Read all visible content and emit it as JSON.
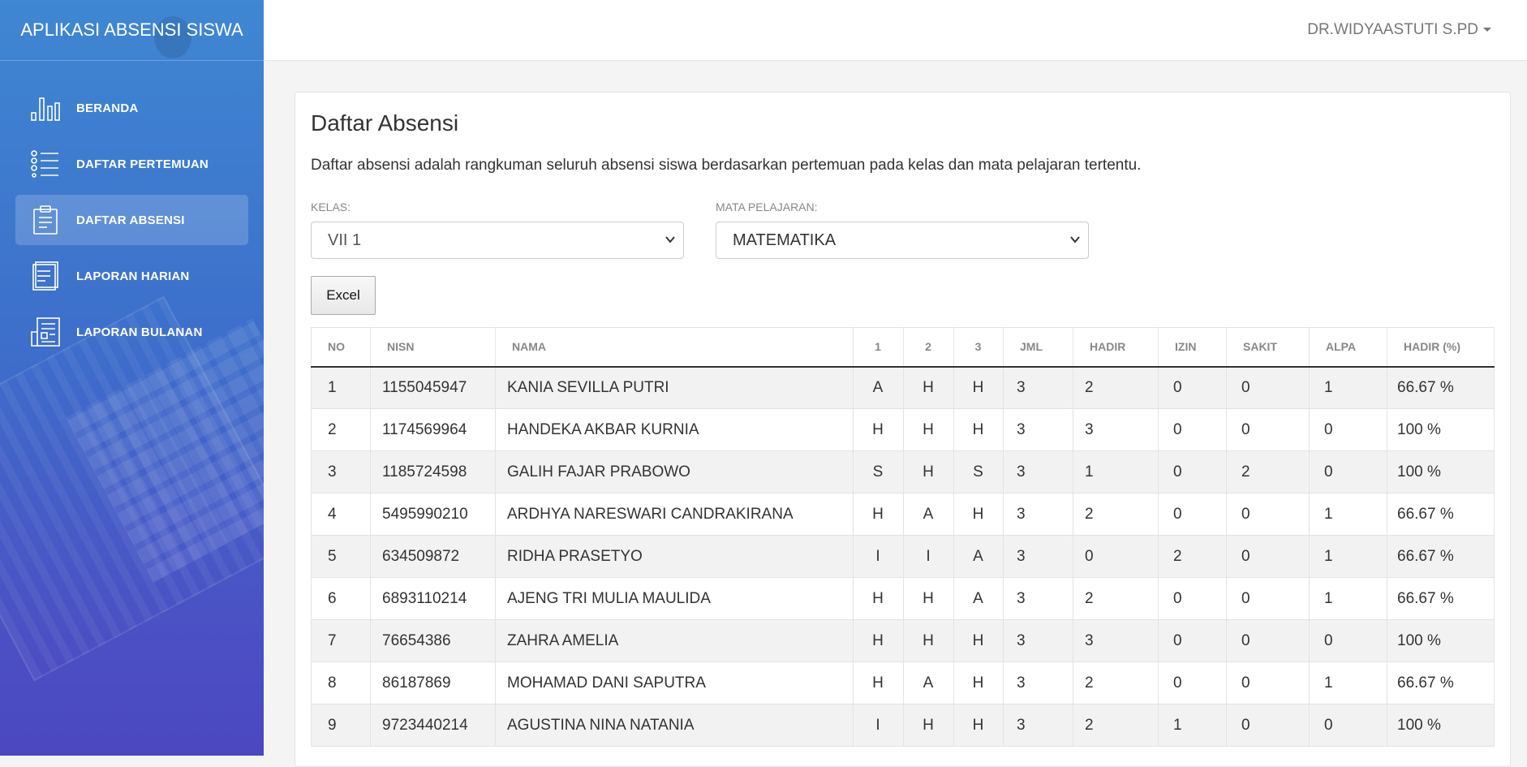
{
  "app": {
    "title": "APLIKASI ABSENSI SISWA"
  },
  "user": {
    "name": "DR.WIDYAASTUTI S.PD"
  },
  "sidebar": {
    "items": [
      {
        "label": "BERANDA",
        "icon": "bar-chart-icon",
        "active": false
      },
      {
        "label": "DAFTAR PERTEMUAN",
        "icon": "list-icon",
        "active": false
      },
      {
        "label": "DAFTAR ABSENSI",
        "icon": "clipboard-icon",
        "active": true
      },
      {
        "label": "LAPORAN HARIAN",
        "icon": "document-icon",
        "active": false
      },
      {
        "label": "LAPORAN BULANAN",
        "icon": "report-icon",
        "active": false
      }
    ]
  },
  "main": {
    "title": "Daftar Absensi",
    "description": "Daftar absensi adalah rangkuman seluruh absensi siswa berdasarkan pertemuan pada kelas dan mata pelajaran tertentu.",
    "kelas": {
      "label": "KELAS:",
      "value": "VII 1"
    },
    "mapel": {
      "label": "MATA PELAJARAN:",
      "value": "MATEMATIKA"
    },
    "excel_label": "Excel"
  },
  "status_colors": {
    "H": "#7ac029",
    "A": "#f04747",
    "S": "#32b2e0",
    "I": "#f39a33"
  },
  "table": {
    "headers": [
      "NO",
      "NISN",
      "NAMA",
      "1",
      "2",
      "3",
      "JML",
      "HADIR",
      "IZIN",
      "SAKIT",
      "ALPA",
      "HADIR (%)"
    ],
    "rows": [
      [
        "1",
        "1155045947",
        "KANIA SEVILLA PUTRI",
        "A",
        "H",
        "H",
        "3",
        "2",
        "0",
        "0",
        "1",
        "66.67 %"
      ],
      [
        "2",
        "1174569964",
        "HANDEKA AKBAR KURNIA",
        "H",
        "H",
        "H",
        "3",
        "3",
        "0",
        "0",
        "0",
        "100 %"
      ],
      [
        "3",
        "1185724598",
        "GALIH FAJAR PRABOWO",
        "S",
        "H",
        "S",
        "3",
        "1",
        "0",
        "2",
        "0",
        "100 %"
      ],
      [
        "4",
        "5495990210",
        "ARDHYA NARESWARI CANDRAKIRANA",
        "H",
        "A",
        "H",
        "3",
        "2",
        "0",
        "0",
        "1",
        "66.67 %"
      ],
      [
        "5",
        "634509872",
        "RIDHA PRASETYO",
        "I",
        "I",
        "A",
        "3",
        "0",
        "2",
        "0",
        "1",
        "66.67 %"
      ],
      [
        "6",
        "6893110214",
        "AJENG TRI MULIA MAULIDA",
        "H",
        "H",
        "A",
        "3",
        "2",
        "0",
        "0",
        "1",
        "66.67 %"
      ],
      [
        "7",
        "76654386",
        "ZAHRA AMELIA",
        "H",
        "H",
        "H",
        "3",
        "3",
        "0",
        "0",
        "0",
        "100 %"
      ],
      [
        "8",
        "86187869",
        "MOHAMAD DANI SAPUTRA",
        "H",
        "A",
        "H",
        "3",
        "2",
        "0",
        "0",
        "1",
        "66.67 %"
      ],
      [
        "9",
        "9723440214",
        "AGUSTINA NINA NATANIA",
        "I",
        "H",
        "H",
        "3",
        "2",
        "1",
        "0",
        "0",
        "100 %"
      ]
    ]
  }
}
